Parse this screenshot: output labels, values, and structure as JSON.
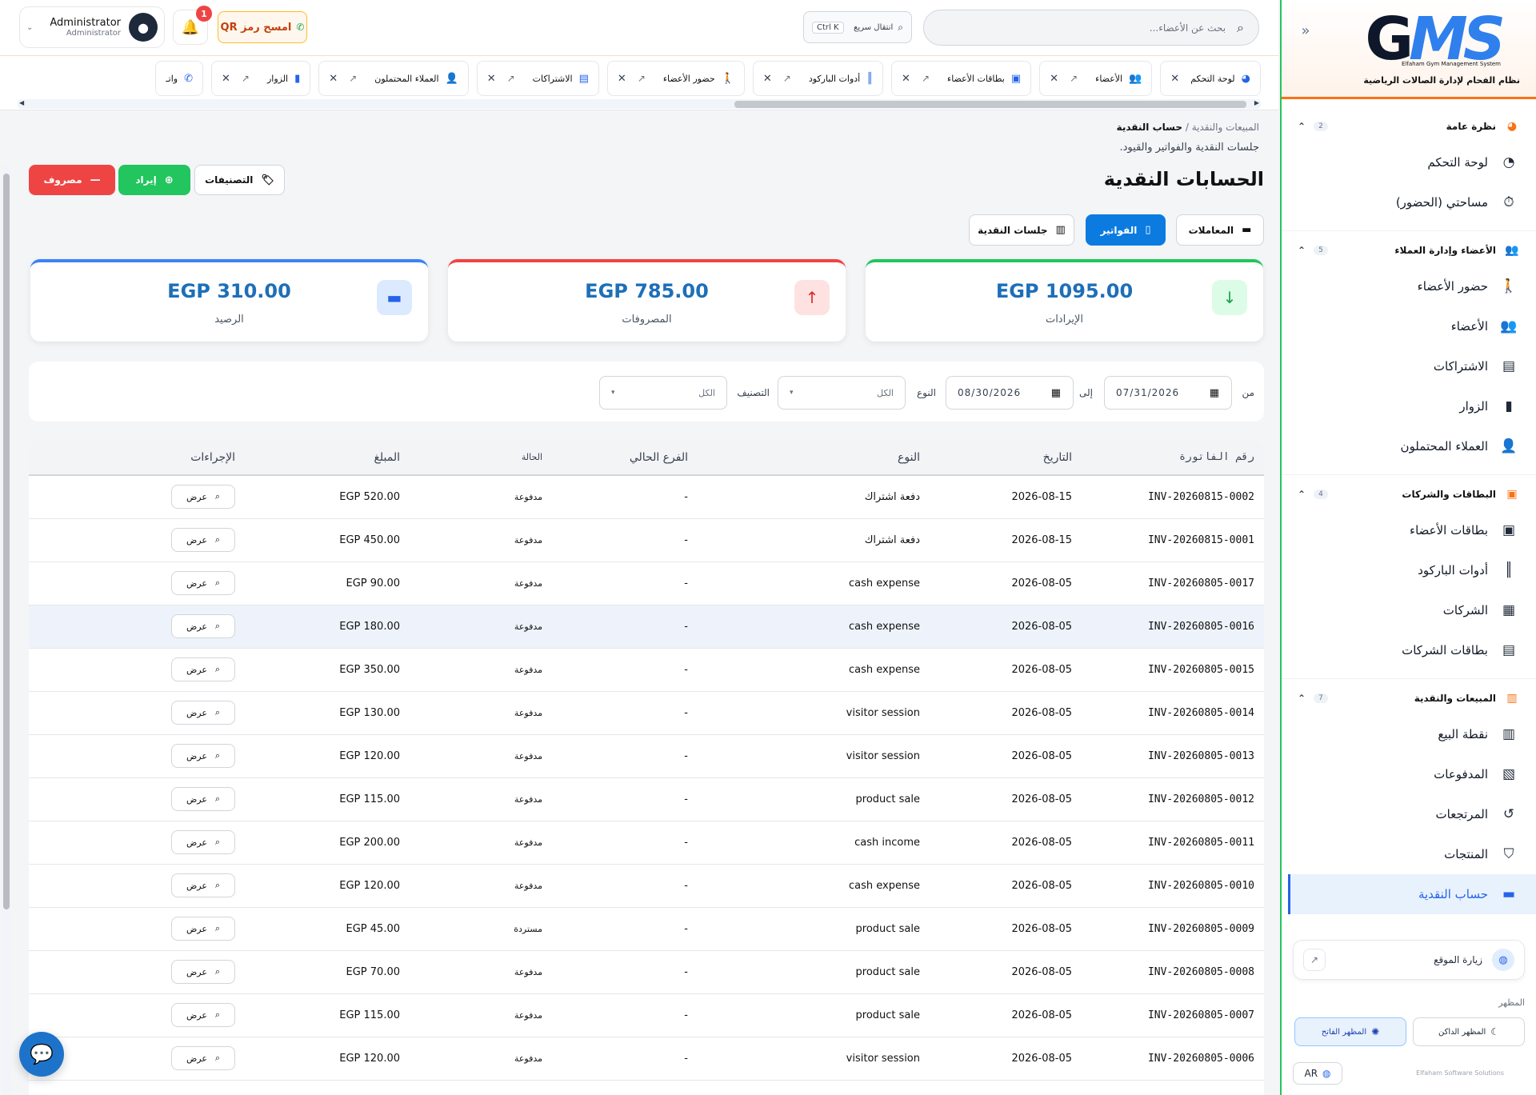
{
  "brand": {
    "logo_text_g": "G",
    "logo_text_ms": "MS",
    "logo_sub": "Elfaham Gym Management System",
    "tagline": "نظام الفحام لإدارة الصالات الرياضية"
  },
  "sidebar": {
    "groups": [
      {
        "title": "نظرة عامة",
        "count": "2",
        "items": [
          {
            "label": "لوحة التحكم",
            "icon": "dashboard-icon"
          },
          {
            "label": "مساحتي (الحضور)",
            "icon": "stopwatch-icon"
          }
        ]
      },
      {
        "title": "الأعضاء وإدارة العملاء",
        "count": "5",
        "items": [
          {
            "label": "حضور الأعضاء",
            "icon": "walking-icon"
          },
          {
            "label": "الأعضاء",
            "icon": "users-icon"
          },
          {
            "label": "الاشتراكات",
            "icon": "id-card-icon"
          },
          {
            "label": "الزوار",
            "icon": "door-icon"
          },
          {
            "label": "العملاء المحتملون",
            "icon": "user-plus-icon"
          }
        ]
      },
      {
        "title": "البطاقات والشركات",
        "count": "4",
        "items": [
          {
            "label": "بطاقات الأعضاء",
            "icon": "badge-icon"
          },
          {
            "label": "أدوات الباركود",
            "icon": "barcode-icon"
          },
          {
            "label": "الشركات",
            "icon": "building-icon"
          },
          {
            "label": "بطاقات الشركات",
            "icon": "address-card-icon"
          }
        ]
      },
      {
        "title": "المبيعات والنقدية",
        "count": "7",
        "items": [
          {
            "label": "نقطة البيع",
            "icon": "cash-register-icon"
          },
          {
            "label": "المدفوعات",
            "icon": "money-icon"
          },
          {
            "label": "المرتجعات",
            "icon": "undo-icon"
          },
          {
            "label": "المنتجات",
            "icon": "basket-icon"
          },
          {
            "label": "حساب النقدية",
            "icon": "wallet-icon"
          }
        ]
      }
    ],
    "visit_site": "زيارة الموقع",
    "theme_label": "المظهر",
    "theme_dark": "المظهر الداكن",
    "theme_light": "المظهر الفاتح",
    "lang": "AR",
    "footer": "Elfaham Software Solutions"
  },
  "header": {
    "search_placeholder": "بحث عن الأعضاء...",
    "quick_label": "انتقال سريع",
    "quick_kbd": "Ctrl K",
    "qr_label": "امسح رمز QR",
    "notif_count": "1",
    "user_name": "Administrator",
    "user_role": "Administrator"
  },
  "tabs": [
    {
      "label": "لوحة التحكم",
      "icon": "dashboard-icon"
    },
    {
      "label": "الأعضاء",
      "icon": "users-icon"
    },
    {
      "label": "بطاقات الأعضاء",
      "icon": "badge-icon"
    },
    {
      "label": "أدوات الباركود",
      "icon": "barcode-icon"
    },
    {
      "label": "حضور الأعضاء",
      "icon": "walking-icon"
    },
    {
      "label": "الاشتراكات",
      "icon": "id-card-icon"
    },
    {
      "label": "العملاء المحتملون",
      "icon": "user-plus-icon"
    },
    {
      "label": "الزوار",
      "icon": "door-icon"
    },
    {
      "label": "واتـ",
      "icon": "whatsapp-icon"
    }
  ],
  "page": {
    "breadcrumb_parent": "المبيعات والنقدية",
    "breadcrumb_current": "حساب النقدية",
    "subtitle": "جلسات النقدية والفواتير والقيود.",
    "title": "الحسابات النقدية",
    "btn_expense": "مصروف",
    "btn_income": "إيراد",
    "btn_categories": "التصنيفات",
    "subtab_transactions": "المعاملات",
    "subtab_invoices": "الفواتير",
    "subtab_sessions": "جلسات النقدية"
  },
  "cards": {
    "income": {
      "value": "EGP 1095.00",
      "label": "الإيرادات"
    },
    "expenses": {
      "value": "EGP 785.00",
      "label": "المصروفات"
    },
    "balance": {
      "value": "EGP 310.00",
      "label": "الرصيد"
    }
  },
  "filters": {
    "from_label": "من",
    "from_value": "07/31/2026",
    "to_label": "إلى",
    "to_value": "08/30/2026",
    "type_label": "النوع",
    "type_value": "الكل",
    "category_label": "التصنيف",
    "category_value": "الكل"
  },
  "table": {
    "headers": [
      "رقم الفاتورة",
      "التاريخ",
      "النوع",
      "الفرع الحالي",
      "الحالة",
      "المبلغ",
      "الإجراءات"
    ],
    "view_label": "عرض",
    "rows": [
      {
        "inv": "INV-20260815-0002",
        "date": "2026-08-15",
        "type": "دفعة اشتراك",
        "branch": "-",
        "status": "مدفوعة",
        "amount": "EGP 520.00"
      },
      {
        "inv": "INV-20260815-0001",
        "date": "2026-08-15",
        "type": "دفعة اشتراك",
        "branch": "-",
        "status": "مدفوعة",
        "amount": "EGP 450.00"
      },
      {
        "inv": "INV-20260805-0017",
        "date": "2026-08-05",
        "type": "cash expense",
        "branch": "-",
        "status": "مدفوعة",
        "amount": "EGP 90.00"
      },
      {
        "inv": "INV-20260805-0016",
        "date": "2026-08-05",
        "type": "cash expense",
        "branch": "-",
        "status": "مدفوعة",
        "amount": "EGP 180.00"
      },
      {
        "inv": "INV-20260805-0015",
        "date": "2026-08-05",
        "type": "cash expense",
        "branch": "-",
        "status": "مدفوعة",
        "amount": "EGP 350.00"
      },
      {
        "inv": "INV-20260805-0014",
        "date": "2026-08-05",
        "type": "visitor session",
        "branch": "-",
        "status": "مدفوعة",
        "amount": "EGP 130.00"
      },
      {
        "inv": "INV-20260805-0013",
        "date": "2026-08-05",
        "type": "visitor session",
        "branch": "-",
        "status": "مدفوعة",
        "amount": "EGP 120.00"
      },
      {
        "inv": "INV-20260805-0012",
        "date": "2026-08-05",
        "type": "product sale",
        "branch": "-",
        "status": "مدفوعة",
        "amount": "EGP 115.00"
      },
      {
        "inv": "INV-20260805-0011",
        "date": "2026-08-05",
        "type": "cash income",
        "branch": "-",
        "status": "مدفوعة",
        "amount": "EGP 200.00"
      },
      {
        "inv": "INV-20260805-0010",
        "date": "2026-08-05",
        "type": "cash expense",
        "branch": "-",
        "status": "مدفوعة",
        "amount": "EGP 120.00"
      },
      {
        "inv": "INV-20260805-0009",
        "date": "2026-08-05",
        "type": "product sale",
        "branch": "-",
        "status": "مستردة",
        "amount": "EGP 45.00"
      },
      {
        "inv": "INV-20260805-0008",
        "date": "2026-08-05",
        "type": "product sale",
        "branch": "-",
        "status": "مدفوعة",
        "amount": "EGP 70.00"
      },
      {
        "inv": "INV-20260805-0007",
        "date": "2026-08-05",
        "type": "product sale",
        "branch": "-",
        "status": "مدفوعة",
        "amount": "EGP 115.00"
      },
      {
        "inv": "INV-20260805-0006",
        "date": "2026-08-05",
        "type": "visitor session",
        "branch": "-",
        "status": "مدفوعة",
        "amount": "EGP 120.00"
      }
    ]
  },
  "colors": {
    "primary": "#0b7be0",
    "income": "#22c55e",
    "expense": "#ef4444",
    "balance": "#3b82f6",
    "accent": "#f97316"
  }
}
